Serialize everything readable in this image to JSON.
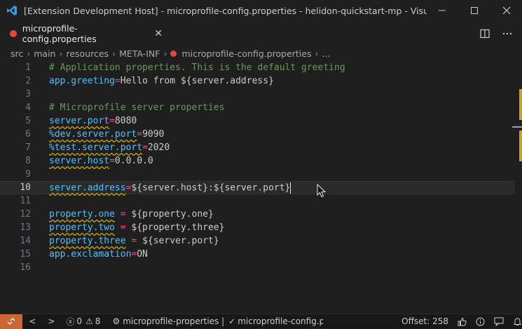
{
  "window": {
    "title": "[Extension Development Host] - microprofile-config.properties - helidon-quickstart-mp - Visual ..."
  },
  "tab": {
    "label": "microprofile-config.properties"
  },
  "breadcrumb": {
    "items": [
      "src",
      "main",
      "resources",
      "META-INF",
      "microprofile-config.properties",
      "..."
    ]
  },
  "editor": {
    "lines": [
      {
        "n": "1",
        "text": "# Application properties. This is the default greeting"
      },
      {
        "n": "2",
        "k": "app.greeting",
        "e": "=",
        "v": "Hello from ${server.address}"
      },
      {
        "n": "3"
      },
      {
        "n": "4",
        "text": "# Microprofile server properties"
      },
      {
        "n": "5",
        "k": "server.port",
        "e": "=",
        "v": "8080"
      },
      {
        "n": "6",
        "k": "%dev.server.port",
        "e": "=",
        "v": "9090"
      },
      {
        "n": "7",
        "k": "%test.server.port",
        "e": "=",
        "v": "2020"
      },
      {
        "n": "8",
        "k": "server.host",
        "e": "=",
        "v": "0.0.0.0"
      },
      {
        "n": "9"
      },
      {
        "n": "10",
        "k": "server.address",
        "e": "=",
        "v": "${server.host}:${server.port}"
      },
      {
        "n": "11"
      },
      {
        "n": "12",
        "k": "property.one",
        "e": " = ",
        "v": "${property.one}"
      },
      {
        "n": "13",
        "k": "property.two",
        "e": " = ",
        "v": "${property.three}"
      },
      {
        "n": "14",
        "k": "property.three",
        "e": " = ",
        "v": "${server.port}"
      },
      {
        "n": "15",
        "k": "app.exclamation",
        "e": "=",
        "v": "ON"
      },
      {
        "n": "16"
      }
    ]
  },
  "status": {
    "prev": "<",
    "next": ">",
    "errors": "0",
    "warnings": "8",
    "project": "microprofile-properties |",
    "file_status": "microprofile-config.pro",
    "offset": "Offset: 258"
  },
  "colors": {
    "remote": "#cc6633",
    "comment": "#6a9955",
    "key": "#4fc1ff",
    "warning": "#cca700"
  }
}
